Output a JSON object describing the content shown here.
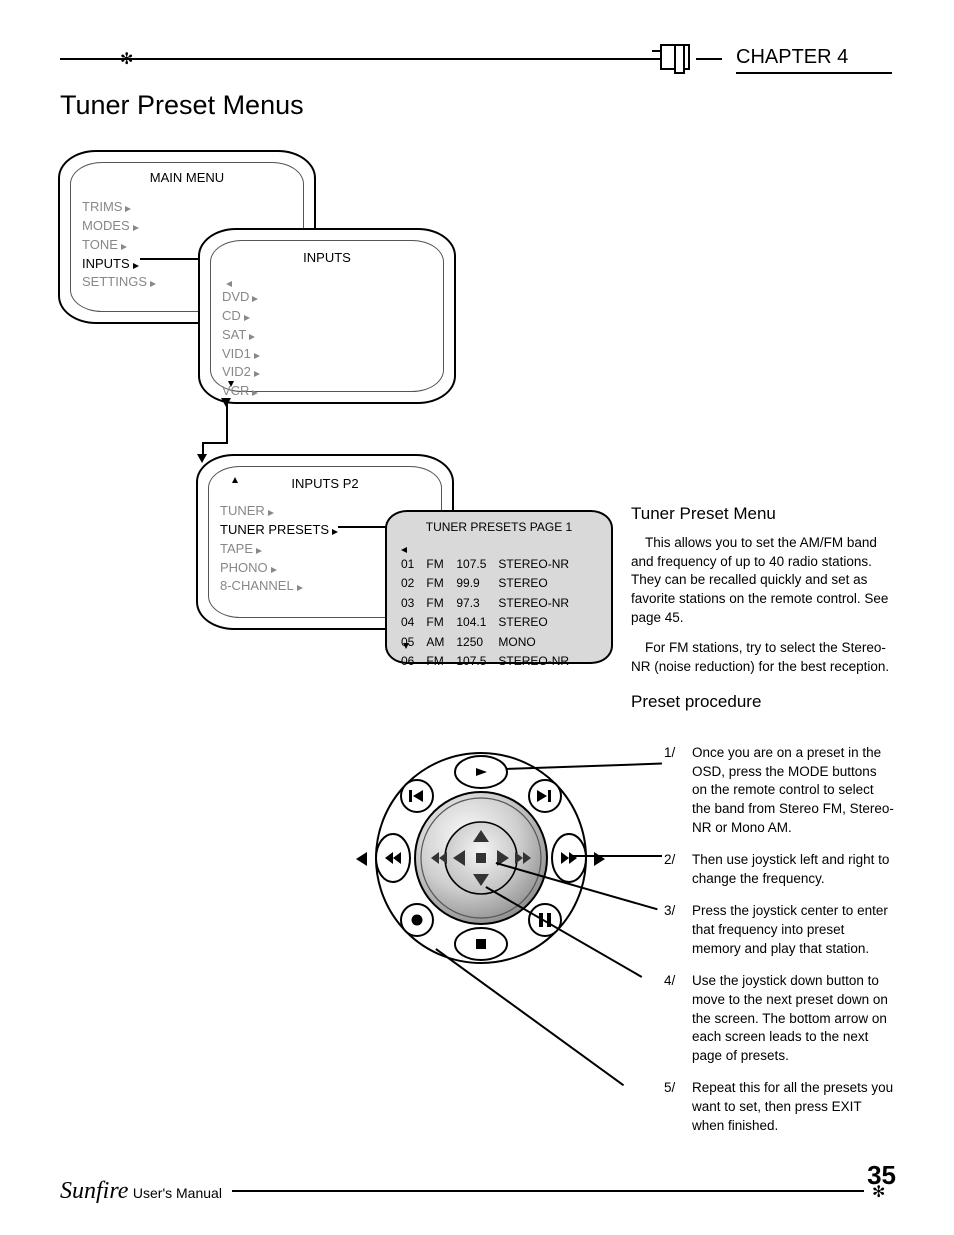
{
  "header": {
    "chapter": "CHAPTER 4",
    "title": "Tuner Preset Menus"
  },
  "menu1": {
    "title": "MAIN MENU",
    "items": [
      "TRIMS",
      "MODES",
      "TONE",
      "INPUTS",
      "SETTINGS"
    ],
    "active_index": 3
  },
  "menu2": {
    "title": "INPUTS",
    "items": [
      "DVD",
      "CD",
      "SAT",
      "VID1",
      "VID2",
      "VCR"
    ]
  },
  "menu3": {
    "title": "INPUTS P2",
    "items": [
      "TUNER",
      "TUNER PRESETS",
      "TAPE",
      "PHONO",
      "8-CHANNEL"
    ],
    "active_index": 1
  },
  "presets": {
    "title": "TUNER PRESETS PAGE 1",
    "rows": [
      {
        "n": "01",
        "band": "FM",
        "freq": "107.5",
        "mode": "STEREO-NR"
      },
      {
        "n": "02",
        "band": "FM",
        "freq": "99.9",
        "mode": "STEREO"
      },
      {
        "n": "03",
        "band": "FM",
        "freq": "97.3",
        "mode": "STEREO-NR"
      },
      {
        "n": "04",
        "band": "FM",
        "freq": "104.1",
        "mode": "STEREO"
      },
      {
        "n": "05",
        "band": "AM",
        "freq": "1250",
        "mode": "MONO"
      },
      {
        "n": "06",
        "band": "FM",
        "freq": "107.5",
        "mode": "STEREO-NR"
      }
    ]
  },
  "right": {
    "h1": "Tuner Preset Menu",
    "p1": "This allows you to set the AM/FM band and frequency of up to 40 radio stations. They can be recalled quickly and set as favorite stations on the remote control. See page 45.",
    "p2": "For FM stations, try to select the Stereo-NR (noise reduction) for the best reception.",
    "h2": "Preset procedure",
    "steps": [
      {
        "n": "1/",
        "t": "Once you are on a preset in the OSD, press the MODE buttons on the remote control to select the band from Stereo FM, Stereo-NR or Mono AM."
      },
      {
        "n": "2/",
        "t": "Then use joystick left and right to change the frequency."
      },
      {
        "n": "3/",
        "t": "Press the joystick center to enter that frequency into preset memory and play that station."
      },
      {
        "n": "4/",
        "t": "Use the joystick down button to move to the next preset down on the screen. The bottom arrow on each screen leads to the next page of presets."
      },
      {
        "n": "5/",
        "t": "Repeat this for all the presets you want to set, then press EXIT when finished."
      }
    ]
  },
  "footer": {
    "brand": "Sunfire",
    "label": "User's Manual",
    "page": "35"
  }
}
